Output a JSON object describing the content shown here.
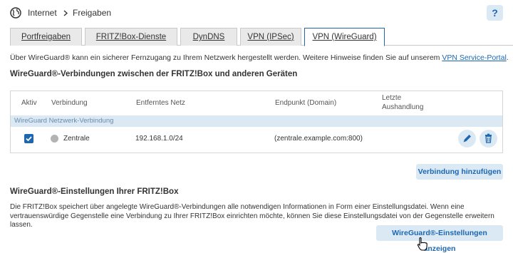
{
  "breadcrumb": {
    "section": "Internet",
    "page": "Freigaben"
  },
  "help_label": "?",
  "tabs": [
    {
      "label": "Portfreigaben"
    },
    {
      "label": "FRITZ!Box-Dienste"
    },
    {
      "label": "DynDNS"
    },
    {
      "label": "VPN (IPSec)"
    },
    {
      "label": "VPN (WireGuard)"
    }
  ],
  "intro": {
    "text": "Über WireGuard® kann ein sicherer Fernzugang zu Ihrem Netzwerk hergestellt werden. Weitere Hinweise finden Sie auf unserem ",
    "link": "VPN Service-Portal",
    "end": "."
  },
  "connections": {
    "title": "WireGuard®-Verbindungen zwischen der FRITZ!Box und anderen Geräten",
    "columns": {
      "aktiv": "Aktiv",
      "verbindung": "Verbindung",
      "netz": "Entferntes Netz",
      "endpunkt": "Endpunkt (Domain)",
      "handshake_1": "Letzte",
      "handshake_2": "Aushandlung"
    },
    "group": "WireGuard Netzwerk-Verbindung",
    "row": {
      "active": true,
      "name": "Zentrale",
      "network": "192.168.1.0/24",
      "endpoint": "(zentrale.example.com:800)",
      "handshake": ""
    },
    "add_button": "Verbindung hinzufügen"
  },
  "settings": {
    "title": "WireGuard®-Einstellungen Ihrer FRITZ!Box",
    "line1": "Die FRITZ!Box speichert über angelegte WireGuard®-Verbindungen alle notwendigen Informationen in Form einer Einstellungsdatei. Wenn eine",
    "line2": "vertrauenswürdige Gegenstelle eine Verbindung zu Ihrer FRITZ!Box einrichten möchte, können Sie diese Einstellungsdatei von der Gegenstelle erweitern lassen.",
    "show_button": "WireGuard®-Einstellungen anzeigen"
  },
  "colors": {
    "accent": "#1d67b0",
    "accent_light": "#dbe9f5",
    "tab_bg": "#e9e9e9"
  }
}
